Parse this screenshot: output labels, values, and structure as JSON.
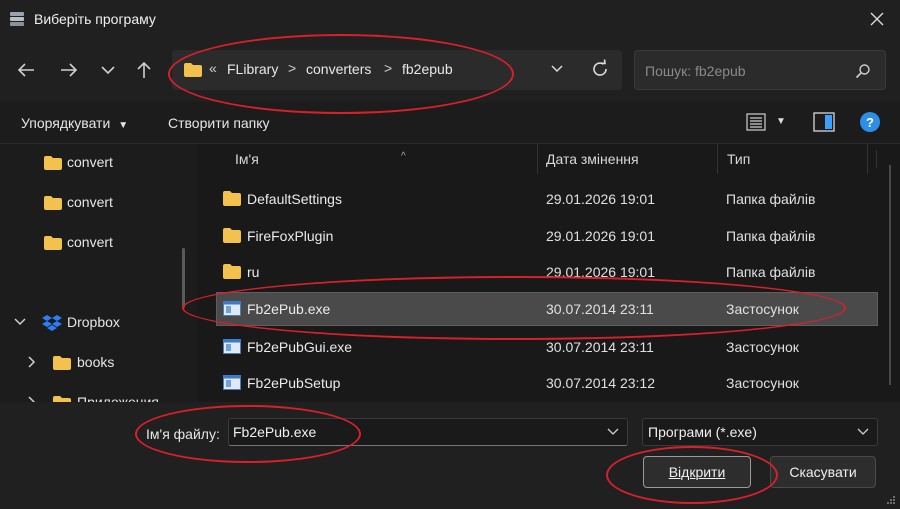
{
  "window": {
    "title": "Виберіть програму"
  },
  "address": {
    "overflow_glyph": "«",
    "crumbs": [
      "FLibrary",
      "converters",
      "fb2epub"
    ],
    "separator": ">"
  },
  "search": {
    "placeholder": "Пошук: fb2epub"
  },
  "toolbar": {
    "organize": "Упорядкувати",
    "new_folder": "Створити папку",
    "help": "?"
  },
  "sidebar": {
    "items": [
      {
        "label": "convert",
        "icon": "folder-icon"
      },
      {
        "label": "convert",
        "icon": "folder-icon"
      },
      {
        "label": "convert",
        "icon": "folder-icon"
      },
      {
        "label": "Dropbox",
        "icon": "dropbox-icon",
        "expanded": true
      },
      {
        "label": "books",
        "icon": "folder-icon"
      },
      {
        "label": "Приложения",
        "icon": "folder-icon"
      }
    ]
  },
  "columns": {
    "name": "Ім'я",
    "date": "Дата змінення",
    "type": "Тип"
  },
  "files": [
    {
      "name": "DefaultSettings",
      "date": "29.01.2026 19:01",
      "type": "Папка файлів",
      "icon": "folder-icon"
    },
    {
      "name": "FireFoxPlugin",
      "date": "29.01.2026 19:01",
      "type": "Папка файлів",
      "icon": "folder-icon"
    },
    {
      "name": "ru",
      "date": "29.01.2026 19:01",
      "type": "Папка файлів",
      "icon": "folder-icon"
    },
    {
      "name": "Fb2ePub.exe",
      "date": "30.07.2014 23:11",
      "type": "Застосунок",
      "icon": "exe-icon",
      "selected": true
    },
    {
      "name": "Fb2ePubGui.exe",
      "date": "30.07.2014 23:11",
      "type": "Застосунок",
      "icon": "exe-icon"
    },
    {
      "name": "Fb2ePubSetup",
      "date": "30.07.2014 23:12",
      "type": "Застосунок",
      "icon": "exe-icon"
    }
  ],
  "footer": {
    "filename_label": "Ім'я файлу:",
    "filename_value": "Fb2ePub.exe",
    "filetype_value": "Програми (*.exe)",
    "open_label": "Відкрити",
    "cancel_label": "Скасувати"
  },
  "colors": {
    "background": "#1c1c1c",
    "accent": "#2d8ee6",
    "annotation": "#d9202a",
    "folder": "#f2c14e"
  }
}
